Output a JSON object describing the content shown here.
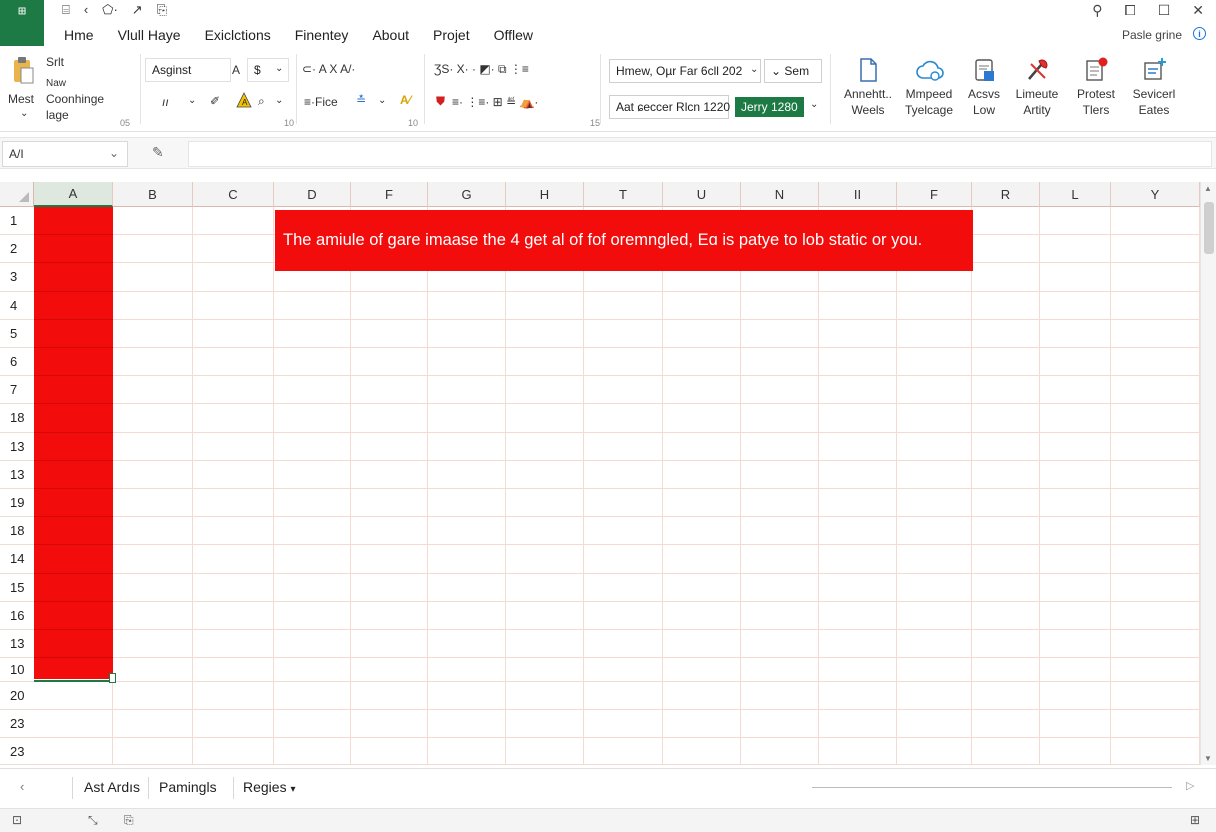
{
  "app": {
    "logo": "⊞"
  },
  "quick_access": [
    "⌸",
    "‹",
    "⬠·",
    "↗",
    "⎘"
  ],
  "menu": {
    "tabs": [
      "Hme",
      "Vlull Haye",
      "Exiclctions",
      "Finentey",
      "About",
      "Projet",
      "Offlew"
    ]
  },
  "window_controls": [
    "⚲",
    "⧠",
    "☐",
    "✕"
  ],
  "top_right": {
    "label": "Pasle grine",
    "info": "i"
  },
  "ribbon": {
    "clipboard": {
      "paste": "Mest",
      "small1": "Srlt",
      "small2": "Naw",
      "small3": "Coonhinge",
      "small4": "lage",
      "group_num": "05"
    },
    "font": {
      "font_name": "Asginst",
      "font_size": "$",
      "row2": "ıı",
      "group_num": "10"
    },
    "alignment": {
      "row1": "⊂· A  X  A/·",
      "fice_label": "≡·Fice",
      "group_num": "10"
    },
    "number": {
      "row1": "ƷS· X· ·  ◩·  ⧉  ⋮≡",
      "row2": "≡· ⋮≡· ⊞ ≝ ⛺·",
      "group_num": "15"
    },
    "fields": {
      "format_box": "Hmew, Oµr Far 6cll 202",
      "sem_box": "Sem",
      "address_box": "Aat ɕeccer Rlcn 1220",
      "badge": "Jerry 1280"
    },
    "big_buttons": [
      {
        "line1": "Annehtt..",
        "line2": "Weels",
        "icon": "document-icon"
      },
      {
        "line1": "Mmpeed",
        "line2": "Tyelcage",
        "icon": "cloud-icon"
      },
      {
        "line1": "Acsvs",
        "line2": "Low",
        "icon": "clipboard-icon"
      },
      {
        "line1": "Limeute",
        "line2": "Artity",
        "icon": "tools-icon"
      },
      {
        "line1": "Protest",
        "line2": "Tlers",
        "icon": "alert-document-icon"
      },
      {
        "line1": "Sevicerl",
        "line2": "Eates",
        "icon": "add-screen-icon"
      }
    ]
  },
  "formula_bar": {
    "name_box": "A/I",
    "fx": "✎",
    "value": ""
  },
  "grid": {
    "columns": [
      "A",
      "B",
      "C",
      "D",
      "F",
      "G",
      "H",
      "T",
      "U",
      "N",
      "II",
      "F",
      "R",
      "L",
      "Y"
    ],
    "rows": [
      "1",
      "2",
      "3",
      "4",
      "5",
      "6",
      "7",
      "18",
      "13",
      "13",
      "19",
      "18",
      "14",
      "15",
      "16",
      "13",
      "10",
      "20",
      "23",
      "23"
    ],
    "banner_text": "The amiule of gare imaase the 4 get al of fof oremngled, Eɑ is patye to lob static or you.",
    "highlight_color": "#f20c0c"
  },
  "sheet_tabs": [
    "Ast Ardıs",
    "Pamingls",
    "Regies"
  ],
  "status": {
    "left1": "⊡",
    "left2": "⤡",
    "left3": "⎘",
    "right": "⊞"
  }
}
